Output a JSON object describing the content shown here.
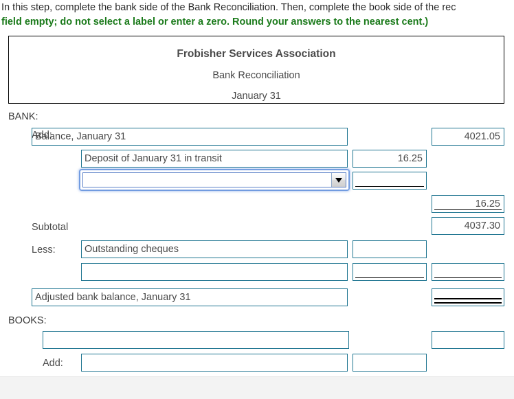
{
  "instructions": {
    "line1": "In this step, complete the bank side of the Bank Reconciliation. Then, complete the book side of the rec",
    "line2": "field empty; do not select a label or enter a zero. Round your answers to the nearest cent.)",
    "line1_color": "#2b2b2b",
    "line2_color": "#1a7a1a"
  },
  "title_box": {
    "company": "Frobisher Services Association",
    "statement": "Bank Reconciliation",
    "date": "January 31"
  },
  "colors": {
    "field_border": "#1d7490",
    "focus_glow": "#7fa3e3",
    "rule": "#000000",
    "text": "#4a4a4a",
    "band": "#f3f3f3"
  },
  "bank_section": {
    "heading": "BANK:",
    "rows": [
      {
        "name": "balance-row",
        "row_label": "",
        "label_value": "Balance, January 31",
        "label_placeholder": "",
        "mid_value": null,
        "right_value": "4021.05"
      },
      {
        "name": "add-deposit-row",
        "row_label": "Add:",
        "label_value": "Deposit of January 31 in transit",
        "label_placeholder": "",
        "mid_value": "16.25",
        "right_value": null
      },
      {
        "name": "add-select-row",
        "row_label": "",
        "select_value": "",
        "select_placeholder": "",
        "select_caret": "chevron-down-icon",
        "mid_value": "",
        "mid_rule": "single",
        "right_value": null
      },
      {
        "name": "add-total-row",
        "row_label": "",
        "right_value": "16.25",
        "right_rule": "single"
      },
      {
        "name": "subtotal-row",
        "row_label": "Subtotal",
        "right_value": "4037.30"
      },
      {
        "name": "less-outstanding-row",
        "row_label": "Less:",
        "label_value": "Outstanding cheques",
        "mid_value": "",
        "right_value": null
      },
      {
        "name": "less-blank-row",
        "row_label": "",
        "label_value": "",
        "mid_value": "",
        "mid_rule": "single",
        "right_value": "",
        "right_rule": "single"
      },
      {
        "name": "adjusted-bank-balance-row",
        "row_label": "",
        "label_value": "Adjusted bank balance, January 31",
        "mid_value": null,
        "right_value": "",
        "right_rule": "double"
      }
    ]
  },
  "books_section": {
    "heading": "BOOKS:",
    "rows": [
      {
        "name": "books-balance-row",
        "row_label": "",
        "label_value": "",
        "mid_value": null,
        "right_value": ""
      },
      {
        "name": "books-add-row",
        "row_label": "Add:",
        "label_value": "",
        "mid_value": "",
        "right_value": null
      }
    ]
  }
}
